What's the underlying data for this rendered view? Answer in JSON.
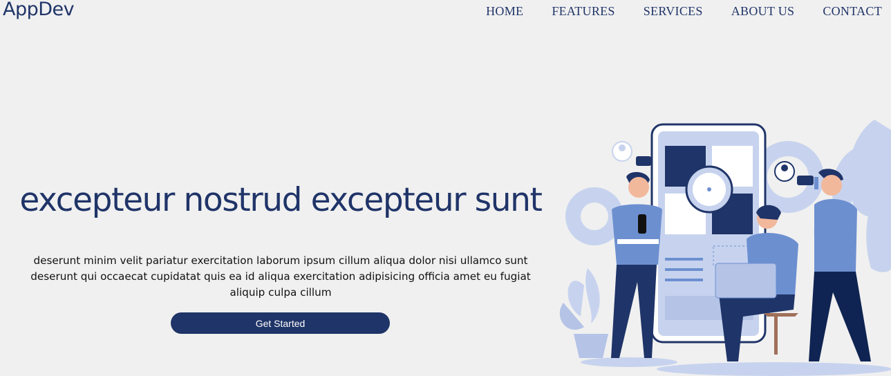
{
  "brand": "AppDev",
  "nav": [
    {
      "label": "HOME"
    },
    {
      "label": "FEATURES"
    },
    {
      "label": "SERVICES"
    },
    {
      "label": "ABOUT US"
    },
    {
      "label": "CONTACT"
    }
  ],
  "hero": {
    "title": "excepteur nostrud excepteur sunt",
    "text": "deserunt minim velit pariatur exercitation laborum ipsum cillum aliqua dolor nisi ullamco sunt deserunt qui occaecat cupidatat quis ea id aliqua exercitation adipisicing officia amet eu fugiat aliquip culpa cillum",
    "cta": "Get Started"
  },
  "colors": {
    "primary": "#1f3468",
    "background": "#f0f0f0",
    "accent_light": "#c7d3ee",
    "accent_mid": "#6c8fd0"
  }
}
